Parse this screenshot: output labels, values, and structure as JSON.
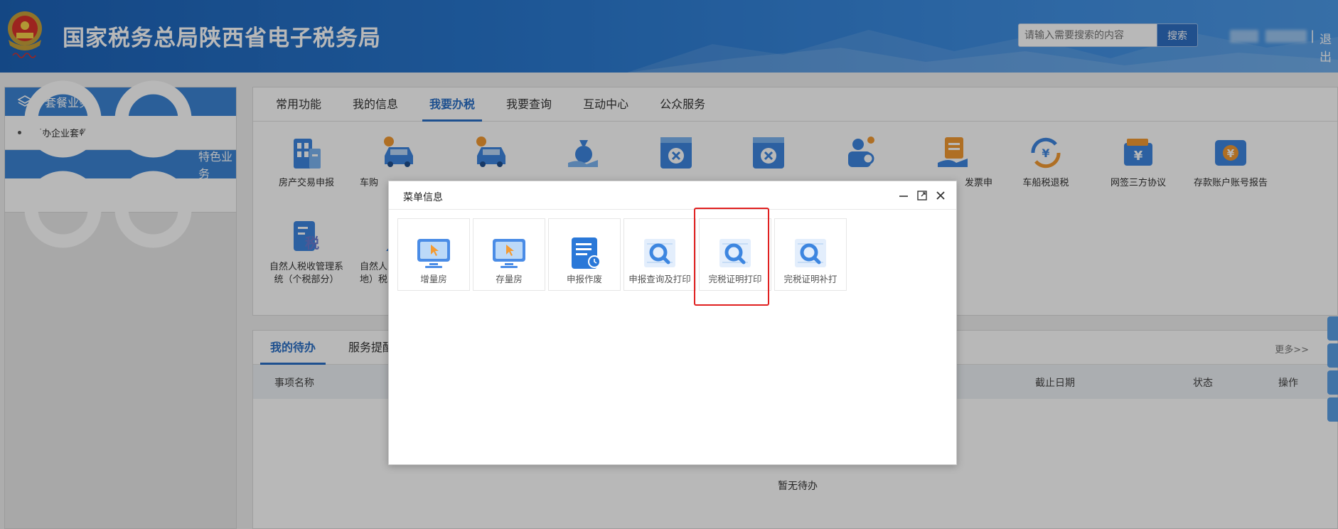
{
  "header": {
    "site_title": "国家税务总局陕西省电子税务局",
    "search_placeholder": "请输入需要搜索的内容",
    "search_button": "搜索",
    "separator": "|",
    "logout": "退出"
  },
  "sidebar": {
    "section1": "套餐业务",
    "item1": "新办企业套餐",
    "section2": "特色业务"
  },
  "main": {
    "tabs": [
      "常用功能",
      "我的信息",
      "我要办税",
      "我要查询",
      "互动中心",
      "公众服务"
    ],
    "active_tab": "我要办税",
    "functions": [
      {
        "label": "房产交易申报",
        "icon": "building-icon"
      },
      {
        "label": "车购",
        "icon": "car-icon"
      },
      {
        "label": "",
        "icon": "car-icon"
      },
      {
        "label": "",
        "icon": "money-bag-icon"
      },
      {
        "label": "",
        "icon": "cancel-window-icon"
      },
      {
        "label": "",
        "icon": "cancel-window-icon"
      },
      {
        "label": "",
        "icon": "user-search-icon"
      },
      {
        "label": "发票申",
        "icon": "invoice-hand-icon"
      },
      {
        "label": "车船税退税",
        "icon": "refund-cycle-icon"
      },
      {
        "label": "网签三方协议",
        "icon": "yuan-card-icon"
      },
      {
        "label": "存款账户账号报告",
        "icon": "yuan-ticket-icon"
      },
      {
        "label": "自然人税收管理系统（个税部分）",
        "icon": "tax-doc-icon"
      },
      {
        "label": "自然人",
        "label2": "地）税",
        "icon": "person-icon"
      }
    ]
  },
  "todo": {
    "tabs": [
      "我的待办",
      "服务提醒"
    ],
    "more": "更多>>",
    "columns": {
      "name": "事项名称",
      "deadline": "截止日期",
      "status": "状态",
      "action": "操作"
    },
    "empty": "暂无待办"
  },
  "modal": {
    "title": "菜单信息",
    "items": [
      {
        "label": "增量房",
        "icon": "monitor-cursor-icon"
      },
      {
        "label": "存量房",
        "icon": "monitor-cursor-icon"
      },
      {
        "label": "申报作废",
        "icon": "document-clock-icon"
      },
      {
        "label": "申报查询及打印",
        "icon": "magnifier-doc-icon"
      },
      {
        "label": "完税证明打印",
        "icon": "magnifier-doc-icon"
      },
      {
        "label": "完税证明补打",
        "icon": "magnifier-doc-icon"
      }
    ]
  },
  "colors": {
    "brand": "#2a6fc6",
    "header": "#2a79d0",
    "highlight": "#e02020"
  }
}
